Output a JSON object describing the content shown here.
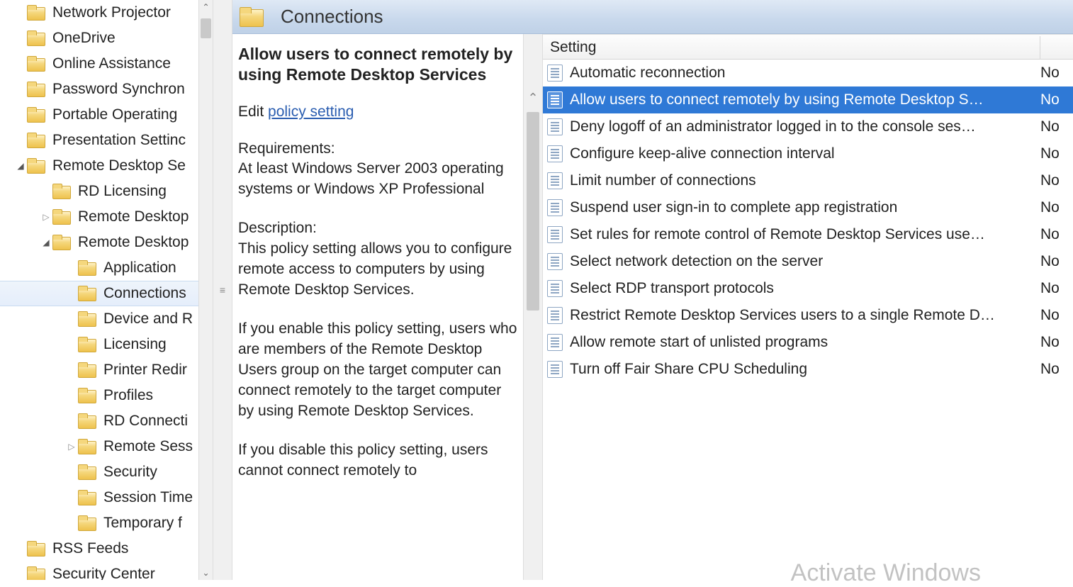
{
  "tree": {
    "items": [
      {
        "indent": 1,
        "expander": "",
        "label": "Network Projector"
      },
      {
        "indent": 1,
        "expander": "",
        "label": "OneDrive"
      },
      {
        "indent": 1,
        "expander": "",
        "label": "Online Assistance"
      },
      {
        "indent": 1,
        "expander": "",
        "label": "Password Synchron"
      },
      {
        "indent": 1,
        "expander": "",
        "label": "Portable Operating"
      },
      {
        "indent": 1,
        "expander": "",
        "label": "Presentation Settinc"
      },
      {
        "indent": 1,
        "expander": "▼",
        "label": "Remote Desktop Se"
      },
      {
        "indent": 2,
        "expander": "",
        "label": "RD Licensing"
      },
      {
        "indent": 2,
        "expander": "▷",
        "label": "Remote Desktop"
      },
      {
        "indent": 2,
        "expander": "▼",
        "label": "Remote Desktop"
      },
      {
        "indent": 3,
        "expander": "",
        "label": "Application"
      },
      {
        "indent": 3,
        "expander": "",
        "label": "Connections",
        "selected": true
      },
      {
        "indent": 3,
        "expander": "",
        "label": "Device and R"
      },
      {
        "indent": 3,
        "expander": "",
        "label": "Licensing"
      },
      {
        "indent": 3,
        "expander": "",
        "label": "Printer Redir"
      },
      {
        "indent": 3,
        "expander": "",
        "label": "Profiles"
      },
      {
        "indent": 3,
        "expander": "",
        "label": "RD Connecti"
      },
      {
        "indent": 3,
        "expander": "▷",
        "label": "Remote Sess"
      },
      {
        "indent": 3,
        "expander": "",
        "label": "Security"
      },
      {
        "indent": 3,
        "expander": "",
        "label": "Session Time"
      },
      {
        "indent": 3,
        "expander": "",
        "label": "Temporary f"
      },
      {
        "indent": 1,
        "expander": "",
        "label": "RSS Feeds"
      },
      {
        "indent": 1,
        "expander": "",
        "label": "Security Center"
      }
    ]
  },
  "header": {
    "title": "Connections"
  },
  "description": {
    "title": "Allow users to connect remotely by using Remote Desktop Services",
    "edit_prefix": "Edit ",
    "edit_link": "policy setting",
    "req_label": "Requirements:",
    "req_text": "At least Windows Server 2003 operating systems or Windows XP Professional",
    "desc_label": "Description:",
    "desc_text": "This policy setting allows you to configure remote access to computers by using Remote Desktop Services.",
    "p2": "If you enable this policy setting, users who are members of the Remote Desktop Users group on the target computer can connect remotely to the target computer by using Remote Desktop Services.",
    "p3": "If you disable this policy setting, users cannot connect remotely to"
  },
  "list": {
    "columns": {
      "setting": "Setting",
      "state": ""
    },
    "rows": [
      {
        "name": "Automatic reconnection",
        "state": "No"
      },
      {
        "name": "Allow users to connect remotely by using Remote Desktop S…",
        "state": "No",
        "selected": true
      },
      {
        "name": "Deny logoff of an administrator logged in to the console ses…",
        "state": "No"
      },
      {
        "name": "Configure keep-alive connection interval",
        "state": "No"
      },
      {
        "name": "Limit number of connections",
        "state": "No"
      },
      {
        "name": "Suspend user sign-in to complete app registration",
        "state": "No"
      },
      {
        "name": "Set rules for remote control of Remote Desktop Services use…",
        "state": "No"
      },
      {
        "name": "Select network detection on the server",
        "state": "No"
      },
      {
        "name": "Select RDP transport protocols",
        "state": "No"
      },
      {
        "name": "Restrict Remote Desktop Services users to a single Remote D…",
        "state": "No"
      },
      {
        "name": "Allow remote start of unlisted programs",
        "state": "No"
      },
      {
        "name": "Turn off Fair Share CPU Scheduling",
        "state": "No"
      }
    ]
  },
  "watermark": "Activate Windows"
}
